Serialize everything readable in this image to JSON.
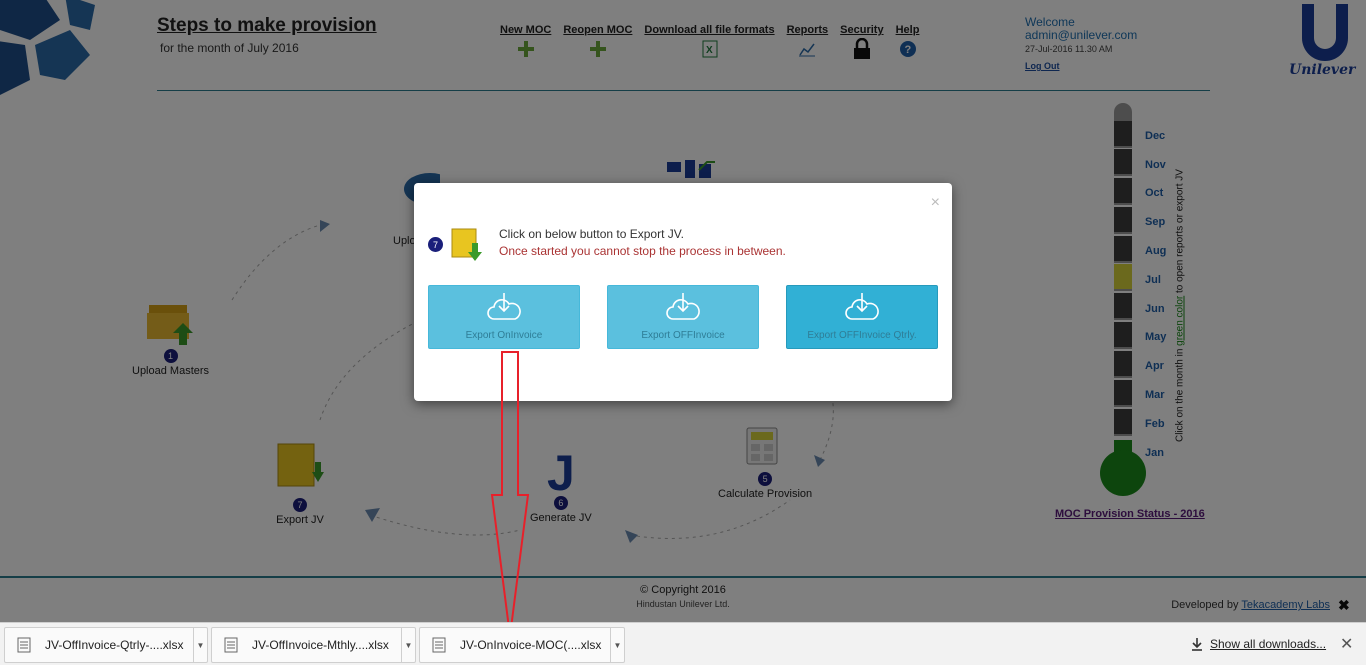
{
  "header": {
    "title": "Steps to make provision",
    "subtitle": "for the month of July 2016",
    "nav": [
      {
        "label": "New MOC",
        "icon": "plus-icon"
      },
      {
        "label": "Reopen MOC",
        "icon": "plus-icon"
      },
      {
        "label": "Download all file formats",
        "icon": "excel-icon"
      },
      {
        "label": "Reports",
        "icon": "chart-icon"
      },
      {
        "label": "Security",
        "icon": "lock-icon"
      },
      {
        "label": "Help",
        "icon": "help-icon"
      }
    ],
    "welcome": "Welcome",
    "user": "admin@unilever.com",
    "datetime": "27-Jul-2016 11.30 AM",
    "logout": "Log Out",
    "logo_text": "Unilever"
  },
  "steps": [
    {
      "num": "1",
      "label": "Upload Masters"
    },
    {
      "num": "",
      "label": "Uplo"
    },
    {
      "num": "5",
      "label": "Calculate Provision"
    },
    {
      "num": "6",
      "label": "Generate JV"
    },
    {
      "num": "7",
      "label": "Export JV"
    }
  ],
  "calendar": {
    "months": [
      "Dec",
      "Nov",
      "Oct",
      "Sep",
      "Aug",
      "Jul",
      "Jun",
      "May",
      "Apr",
      "Mar",
      "Feb",
      "Jan"
    ],
    "active_month": "Jul",
    "note_prefix": "Click on the month in",
    "note_green": "green color",
    "note_suffix": "to open reports or export JV",
    "status_link": "MOC Provision Status - 2016",
    "colors": {
      "active": "#d6d23a",
      "inactive": "#3c3c3c",
      "bulb": "#1a8a1a"
    }
  },
  "modal": {
    "step_num": "7",
    "message": "Click on below button to Export JV.",
    "warning": "Once started you cannot stop the process in between.",
    "close": "×",
    "buttons": [
      {
        "label": "Export OnInvoice"
      },
      {
        "label": "Export OFFInvoice"
      },
      {
        "label": "Export OFFInvoice Qtrly."
      }
    ]
  },
  "footer": {
    "copyright": "© Copyright 2016",
    "company": "Hindustan Unilever Ltd.",
    "developed_by": "Developed by",
    "developer": "Tekacademy Labs",
    "close": "✖"
  },
  "downloads": {
    "items": [
      "JV-OffInvoice-Qtrly-....xlsx",
      "JV-OffInvoice-Mthly....xlsx",
      "JV-OnInvoice-MOC(....xlsx"
    ],
    "show_all": "Show all downloads...",
    "close": "✕"
  }
}
